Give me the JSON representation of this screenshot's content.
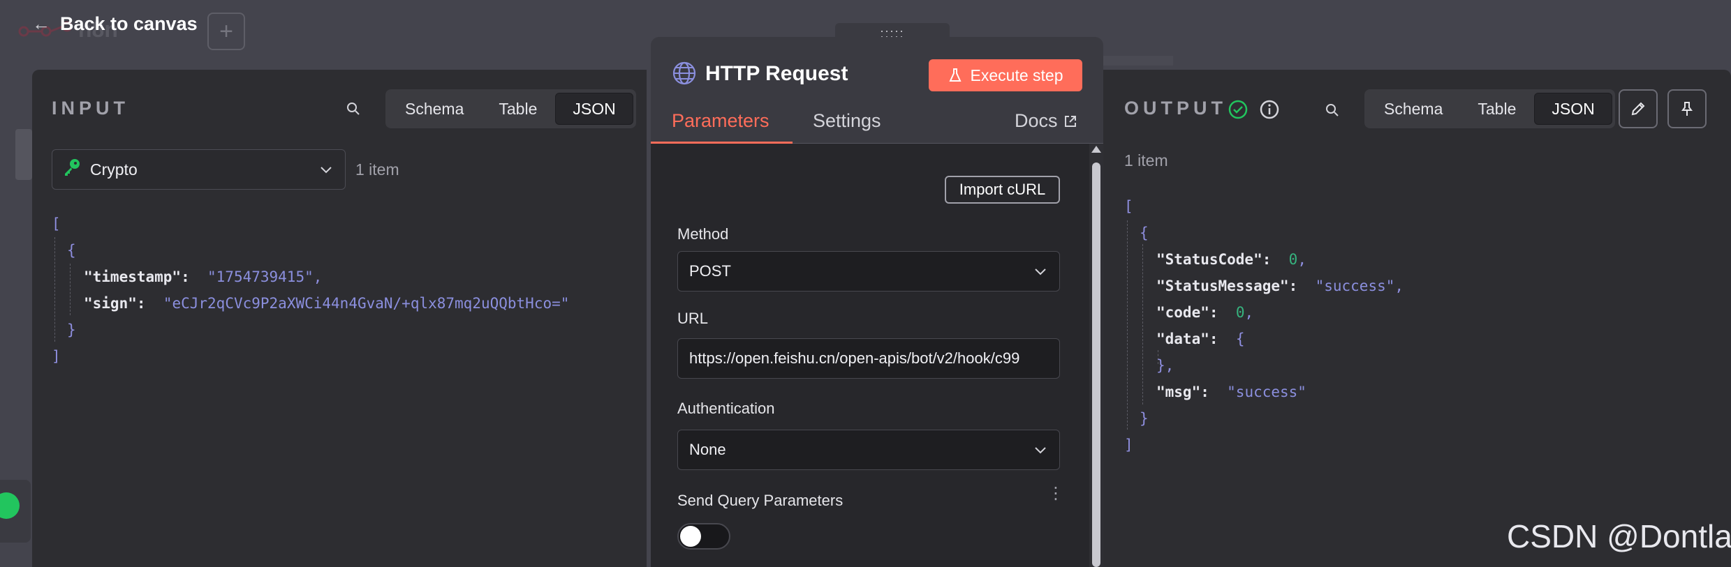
{
  "topbar": {
    "back_label": "Back to canvas",
    "plus_label": "+",
    "bg_brand_text": "n8n"
  },
  "input": {
    "title": "INPUT",
    "tabs": [
      "Schema",
      "Table",
      "JSON"
    ],
    "active_tab": "JSON",
    "selector_value": "Crypto",
    "item_count": "1 item",
    "json": {
      "open_bracket": "[",
      "open_brace": "{",
      "close_brace": "}",
      "close_bracket": "]",
      "timestamp_key": "\"timestamp\":",
      "timestamp_value": "\"1754739415\"",
      "sign_key": "\"sign\":",
      "sign_value": "\"eCJr2qCVc9P2aXWCi44n4GvaN/+qlx87mq2uQQbtHco=\"",
      "comma": ","
    }
  },
  "node": {
    "title": "HTTP Request",
    "execute_label": "Execute step",
    "tabs": {
      "parameters": "Parameters",
      "settings": "Settings",
      "docs": "Docs"
    },
    "import_curl": "Import cURL",
    "method": {
      "label": "Method",
      "value": "POST"
    },
    "url": {
      "label": "URL",
      "value": "https://open.feishu.cn/open-apis/bot/v2/hook/c99"
    },
    "auth": {
      "label": "Authentication",
      "value": "None"
    },
    "send_query": {
      "label": "Send Query Parameters",
      "enabled": false
    },
    "drag_dots": ":::::",
    "accent_color": "#ff6d5a"
  },
  "output": {
    "title": "OUTPUT",
    "tabs": [
      "Schema",
      "Table",
      "JSON"
    ],
    "active_tab": "JSON",
    "item_count": "1 item",
    "json": {
      "open_bracket": "[",
      "open_brace": "{",
      "status_code_key": "\"StatusCode\":",
      "status_code_value": "0",
      "status_message_key": "\"StatusMessage\":",
      "status_message_value": "\"success\"",
      "code_key": "\"code\":",
      "code_value": "0",
      "data_key": "\"data\":",
      "data_open": "{",
      "data_close": "},",
      "msg_key": "\"msg\":",
      "msg_value": "\"success\"",
      "close_brace": "}",
      "close_bracket": "]",
      "comma": ","
    }
  },
  "watermark": "CSDN @Dontla"
}
